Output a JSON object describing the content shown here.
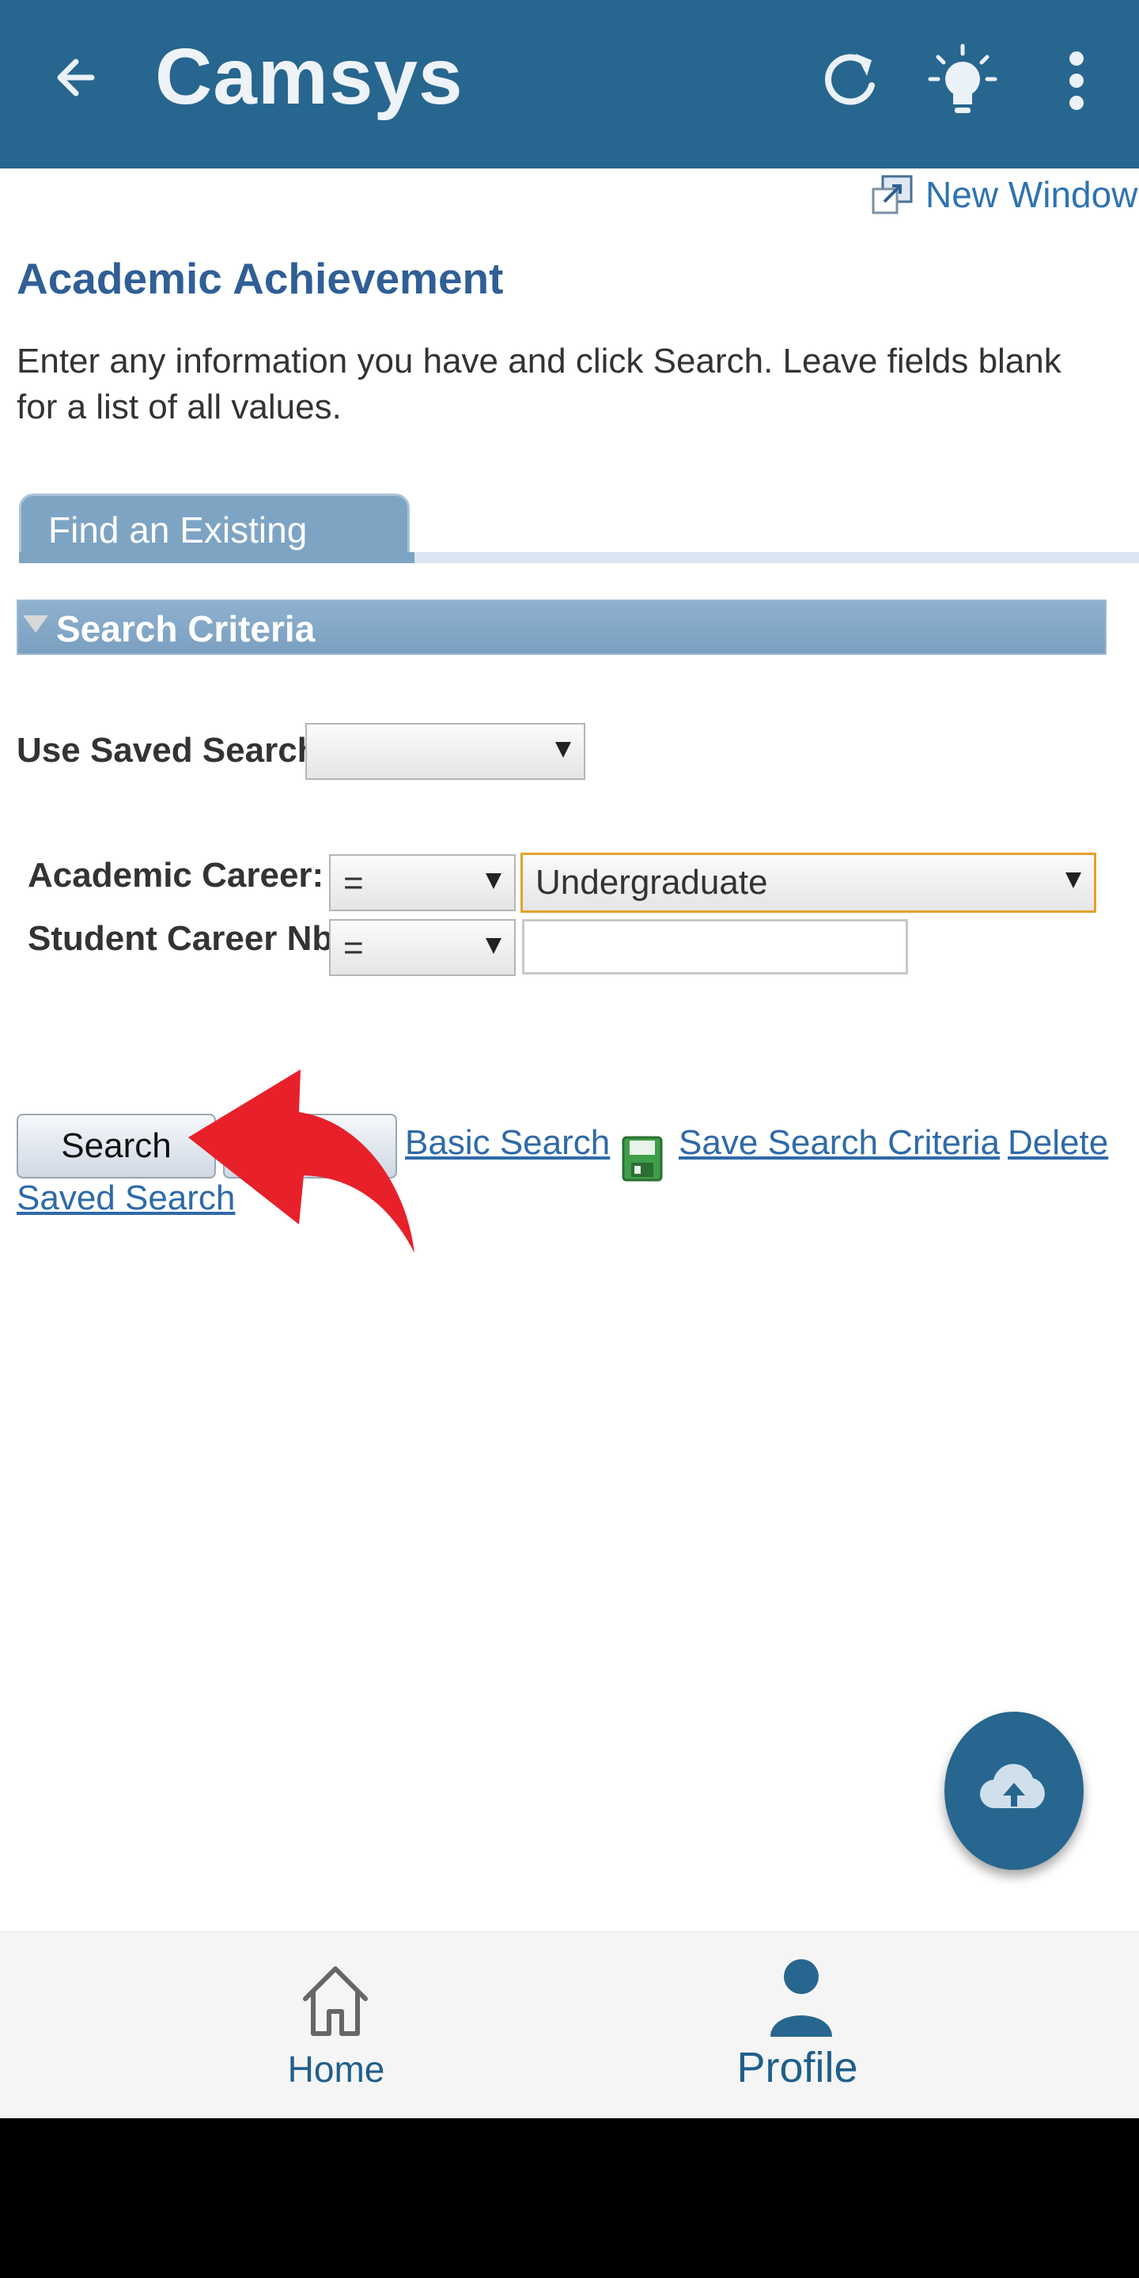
{
  "appbar": {
    "title": "Camsys",
    "background": "#27668f",
    "icons": [
      "back-arrow-icon",
      "refresh-icon",
      "lightbulb-icon",
      "more-vert-icon"
    ]
  },
  "page": {
    "new_window_label": "New Window",
    "title": "Academic Achievement",
    "instructions": "Enter any information you have and click Search. Leave fields blank for a list of all values."
  },
  "tabs": [
    {
      "label": "Find an Existing Value",
      "active": true
    }
  ],
  "search_criteria": {
    "section_label": "Search Criteria",
    "saved_search_label": "Use Saved Search:",
    "saved_search_value": "",
    "fields": [
      {
        "label": "Academic Career:",
        "operator": "=",
        "value": "Undergraduate",
        "type": "select"
      },
      {
        "label": "Student Career Nbr:",
        "operator": "=",
        "value": "",
        "type": "text"
      }
    ]
  },
  "actions": {
    "search_label": "Search",
    "clear_label": "",
    "basic_search_label": "Basic Search",
    "save_search_label": "Save Search Criteria",
    "delete_saved_search_label": "Delete Saved Search",
    "delete_saved_search_line1": "Delete",
    "delete_saved_search_line2": "Saved Search"
  },
  "fab": {
    "icon": "cloud-upload-icon"
  },
  "bottom_nav": {
    "items": [
      {
        "label": "Home",
        "icon": "home-icon",
        "active": false
      },
      {
        "label": "Profile",
        "icon": "person-icon",
        "active": true
      }
    ]
  },
  "colors": {
    "accent": "#27668f",
    "link": "#2f6aa8",
    "title": "#2f5f96",
    "annotation_arrow": "#e8202a"
  }
}
